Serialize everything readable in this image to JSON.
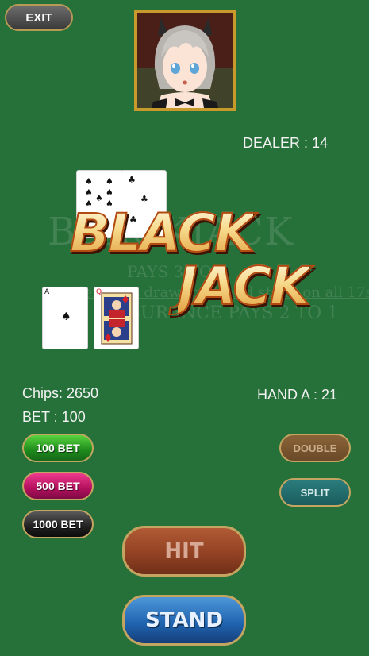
{
  "header": {
    "exit_label": "EXIT"
  },
  "dealer": {
    "score_text": "DEALER : 14",
    "cards": [
      {
        "rank": "9",
        "suit": "♠",
        "color": "#111111"
      },
      {
        "rank": "5",
        "suit": "♣",
        "color": "#111111"
      }
    ]
  },
  "table_print": {
    "title": "BLACKJACK",
    "pays": "PAYS 3 TO 2",
    "rule": "Dealer must draw to 16 and stand on all 17s",
    "insurance": "INSURANCE PAYS 2 TO 1"
  },
  "banner": {
    "line1": "BLACK",
    "line2": "JACK"
  },
  "player": {
    "chips_text": "Chips: 2650",
    "bet_text": "BET : 100",
    "hand_text": "HAND A : 21",
    "cards": [
      {
        "rank": "A",
        "suit": "♠",
        "color": "#111111"
      },
      {
        "rank": "Q",
        "suit": "♦",
        "color": "#d6202b"
      }
    ]
  },
  "buttons": {
    "bet100": "100 BET",
    "bet500": "500 BET",
    "bet1000": "1000 BET",
    "double": "DOUBLE",
    "split": "SPLIT",
    "hit": "HIT",
    "stand": "STAND"
  },
  "icons": {
    "exit": "exit-button",
    "dealer_portrait": "dealer-portrait"
  }
}
